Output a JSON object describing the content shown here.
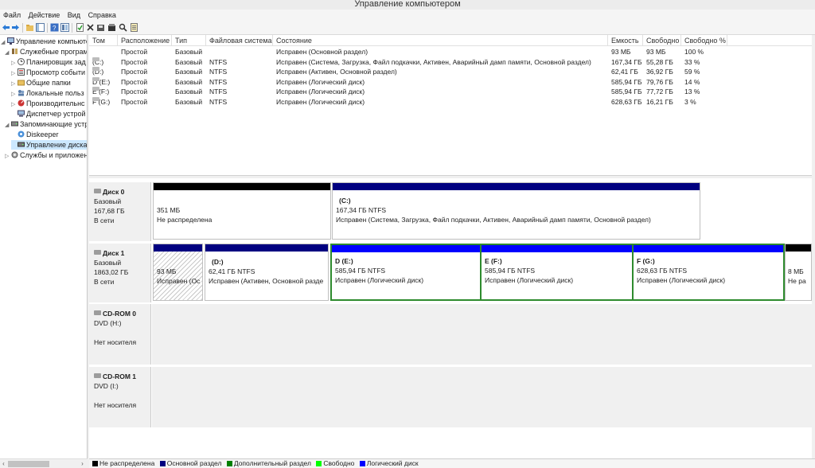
{
  "window": {
    "title": "Управление компьютером"
  },
  "menu": [
    "Файл",
    "Действие",
    "Вид",
    "Справка"
  ],
  "toolbar": {
    "icons": [
      "back-arrow-icon",
      "forward-arrow-icon",
      "up-folder-icon",
      "console-tree-icon",
      "help-icon",
      "properties-icon",
      "refresh-icon",
      "delete-icon",
      "disk-properties-icon",
      "open-icon",
      "search-icon",
      "help-book-icon"
    ]
  },
  "tree": {
    "root": "Управление компьютер",
    "items": [
      {
        "label": "Служебные програм",
        "icon": "tools-icon"
      },
      {
        "label": "Планировщик зад",
        "icon": "clock-icon"
      },
      {
        "label": "Просмотр событи",
        "icon": "event-viewer-icon"
      },
      {
        "label": "Общие папки",
        "icon": "shared-folder-icon"
      },
      {
        "label": "Локальные польз",
        "icon": "users-icon"
      },
      {
        "label": "Производительнс",
        "icon": "performance-icon"
      },
      {
        "label": "Диспетчер устрой",
        "icon": "device-manager-icon"
      },
      {
        "label": "Запоминающие устр",
        "icon": "storage-icon"
      },
      {
        "label": "Diskeeper",
        "icon": "diskeeper-icon"
      },
      {
        "label": "Управление диска",
        "icon": "disk-management-icon"
      },
      {
        "label": "Службы и приложен",
        "icon": "services-icon"
      }
    ]
  },
  "volumes": {
    "headers": [
      "Том",
      "Расположение",
      "Тип",
      "Файловая система",
      "Состояние",
      "Емкость",
      "Свободно",
      "Свободно %"
    ],
    "rows": [
      [
        "",
        "Простой",
        "Базовый",
        "",
        "Исправен (Основной раздел)",
        "93 МБ",
        "93 МБ",
        "100 %"
      ],
      [
        "(C:)",
        "Простой",
        "Базовый",
        "NTFS",
        "Исправен (Система, Загрузка, Файл подкачки, Активен, Аварийный дамп памяти, Основной раздел)",
        "167,34 ГБ",
        "55,28 ГБ",
        "33 %"
      ],
      [
        "(D:)",
        "Простой",
        "Базовый",
        "NTFS",
        "Исправен (Активен, Основной раздел)",
        "62,41 ГБ",
        "36,92 ГБ",
        "59 %"
      ],
      [
        "D (E:)",
        "Простой",
        "Базовый",
        "NTFS",
        "Исправен (Логический диск)",
        "585,94 ГБ",
        "79,76 ГБ",
        "14 %"
      ],
      [
        "E (F:)",
        "Простой",
        "Базовый",
        "NTFS",
        "Исправен (Логический диск)",
        "585,94 ГБ",
        "77,72 ГБ",
        "13 %"
      ],
      [
        "F (G:)",
        "Простой",
        "Базовый",
        "NTFS",
        "Исправен (Логический диск)",
        "628,63 ГБ",
        "16,21 ГБ",
        "3 %"
      ]
    ]
  },
  "disks": [
    {
      "name": "Диск 0",
      "type": "Базовый",
      "size": "167,68 ГБ",
      "status": "В сети",
      "partitions": [
        {
          "title": "",
          "size": "351 МБ",
          "state": "Не распределена"
        },
        {
          "title": "(C:)",
          "size": "167,34 ГБ NTFS",
          "state": "Исправен (Система, Загрузка, Файл подкачки, Активен, Аварийный дамп памяти, Основной раздел)"
        }
      ]
    },
    {
      "name": "Диск 1",
      "type": "Базовый",
      "size": "1863,02 ГБ",
      "status": "В сети",
      "partitions": [
        {
          "title": "",
          "size": "93 МБ",
          "state": "Исправен (Ос"
        },
        {
          "title": "(D:)",
          "size": "62,41 ГБ NTFS",
          "state": "Исправен (Активен, Основной разде"
        },
        {
          "title": "D  (E:)",
          "size": "585,94 ГБ NTFS",
          "state": "Исправен (Логический диск)"
        },
        {
          "title": "E  (F:)",
          "size": "585,94 ГБ NTFS",
          "state": "Исправен (Логический диск)"
        },
        {
          "title": "F  (G:)",
          "size": "628,63 ГБ NTFS",
          "state": "Исправен (Логический диск)"
        },
        {
          "title": "",
          "size": "8 МБ",
          "state": "Не ра"
        }
      ]
    },
    {
      "name": "CD-ROM 0",
      "type": "DVD (H:)",
      "status": "Нет носителя"
    },
    {
      "name": "CD-ROM 1",
      "type": "DVD (I:)",
      "status": "Нет носителя"
    }
  ],
  "legend": [
    {
      "label": "Не распределена",
      "color": "#000000"
    },
    {
      "label": "Основной раздел",
      "color": "#000080"
    },
    {
      "label": "Дополнительный раздел",
      "color": "#008000"
    },
    {
      "label": "Свободно",
      "color": "#00ff00"
    },
    {
      "label": "Логический диск",
      "color": "#0000ff"
    }
  ],
  "colors": {
    "unallocated": "#000000",
    "primary": "#000080",
    "logical": "#0000ff",
    "extended": "#2e8b2e",
    "selected": "#cce8ff"
  }
}
